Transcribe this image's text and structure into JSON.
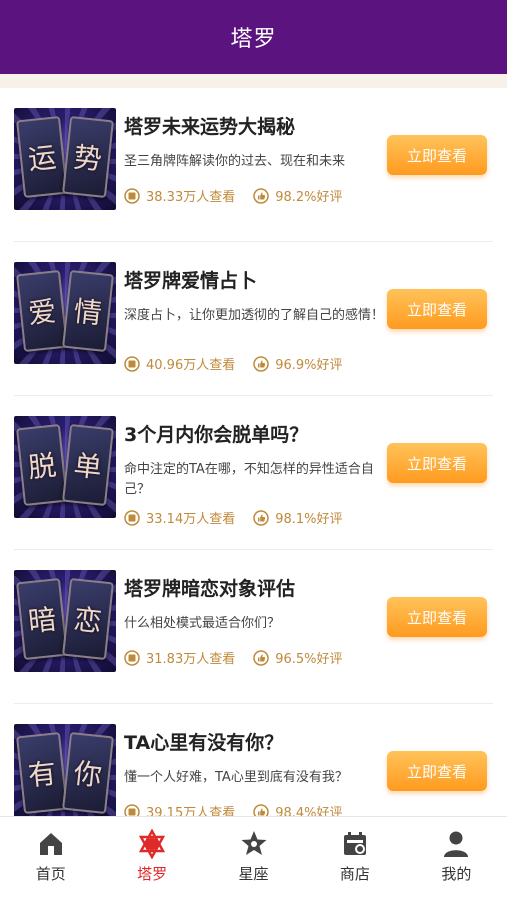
{
  "header": {
    "title": "塔罗"
  },
  "action_label": "立即查看",
  "items": [
    {
      "chars": [
        "运",
        "势"
      ],
      "title": "塔罗未来运势大揭秘",
      "desc": "圣三角牌阵解读你的过去、现在和未来",
      "views": "38.33万人查看",
      "rating": "98.2%好评"
    },
    {
      "chars": [
        "爱",
        "情"
      ],
      "title": "塔罗牌爱情占卜",
      "desc": "深度占卜，让你更加透彻的了解自己的感情！",
      "views": "40.96万人查看",
      "rating": "96.9%好评"
    },
    {
      "chars": [
        "脱",
        "单"
      ],
      "title": "3个月内你会脱单吗？",
      "desc": "命中注定的TA在哪，不知怎样的异性适合自己？",
      "views": "33.14万人查看",
      "rating": "98.1%好评"
    },
    {
      "chars": [
        "暗",
        "恋"
      ],
      "title": "塔罗牌暗恋对象评估",
      "desc": "什么相处模式最适合你们？",
      "views": "31.83万人查看",
      "rating": "96.5%好评"
    },
    {
      "chars": [
        "有",
        "你"
      ],
      "title": "TA心里有没有你？",
      "desc": "懂一个人好难，TA心里到底有没有我？",
      "views": "39.15万人查看",
      "rating": "98.4%好评"
    }
  ],
  "tabbar": {
    "items": [
      {
        "label": "首页",
        "icon": "home-icon"
      },
      {
        "label": "塔罗",
        "icon": "tarot-icon"
      },
      {
        "label": "星座",
        "icon": "zodiac-icon"
      },
      {
        "label": "商店",
        "icon": "shop-icon"
      },
      {
        "label": "我的",
        "icon": "profile-icon"
      }
    ],
    "active_index": 1
  },
  "colors": {
    "header": "#5a137f",
    "accent": "#ff9a1f",
    "stat_text": "#c08a3c",
    "active_tab": "#e02a2a"
  }
}
